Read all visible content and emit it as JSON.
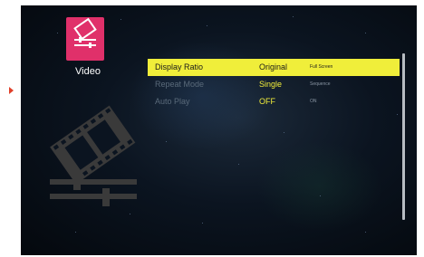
{
  "category": {
    "icon": "film-strip-sliders-icon",
    "label": "Video",
    "tile_color": "#e0306a"
  },
  "settings": [
    {
      "name": "Display Ratio",
      "value": "Original",
      "option": "Full Screen",
      "selected": true
    },
    {
      "name": "Repeat Mode",
      "value": "Single",
      "option": "Sequence",
      "selected": false
    },
    {
      "name": "Auto Play",
      "value": "OFF",
      "option": "ON",
      "selected": false
    }
  ],
  "colors": {
    "highlight": "#f0ee3a",
    "value_text": "#f2ee3a",
    "accent_marker": "#e0402a"
  }
}
